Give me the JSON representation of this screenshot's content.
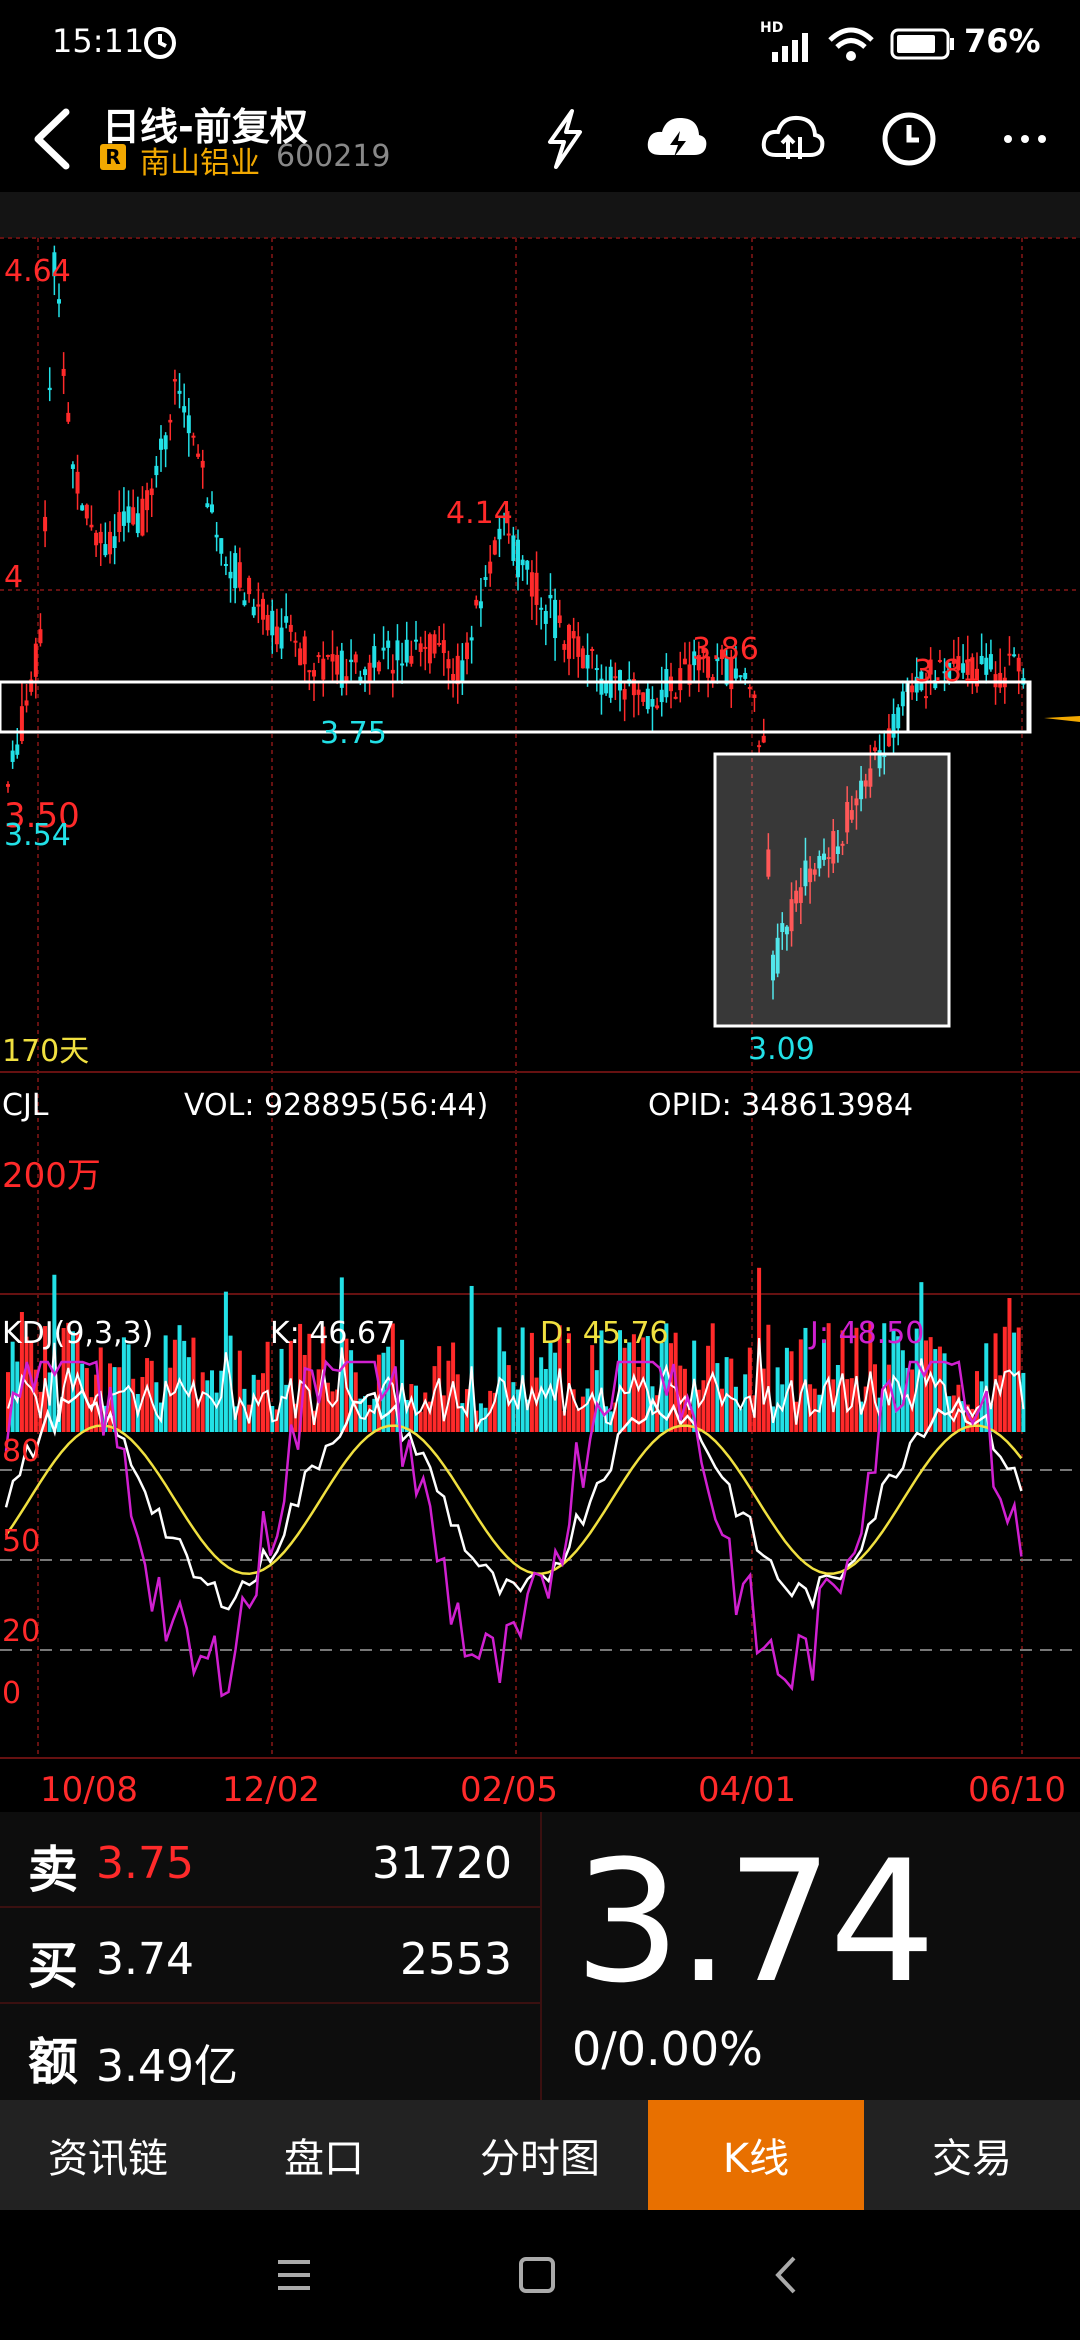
{
  "status_bar": {
    "time": "15:11",
    "battery": "76%",
    "network": "HD"
  },
  "header": {
    "title": "日线-前复权",
    "badge": "R",
    "stock_name": "南山铝业",
    "stock_code": "600219"
  },
  "chart_labels": {
    "high_main": "4.64",
    "level_4": "4",
    "level_3_50": "3.50",
    "low_left": "3.54",
    "peak_mid": "4.14",
    "low_mid": "3.75",
    "peak_386": "3.86",
    "peak_381": "3.81",
    "low_309": "3.09",
    "days": "170天"
  },
  "volume_panel": {
    "name": "CJL",
    "vol": "VOL: 928895(56:44)",
    "opid": "OPID: 348613984",
    "scale": "200万"
  },
  "kdj_panel": {
    "name": "KDJ(9,3,3)",
    "k": "K: 46.67",
    "d": "D: 45.76",
    "j": "J: 48.50",
    "levels": [
      "80",
      "50",
      "20",
      "0"
    ]
  },
  "dates": [
    "10/08",
    "12/02",
    "02/05",
    "04/01",
    "06/10"
  ],
  "quote": {
    "sell_label": "卖",
    "sell_price": "3.75",
    "sell_volume": "31720",
    "buy_label": "买",
    "buy_price": "3.74",
    "buy_volume": "2553",
    "amount_label": "额",
    "amount_value": "3.49亿",
    "last_price": "3.74",
    "change": "0/0.00%"
  },
  "tabs": [
    "资讯链",
    "盘口",
    "分时图",
    "K线",
    "交易"
  ],
  "active_tab": 3,
  "colors": {
    "up": "#ff2a2a",
    "down": "#22e0e6",
    "k_line": "#ffffff",
    "d_line": "#f0e040",
    "j_line": "#d020d0",
    "accent": "#e87000"
  },
  "chart_data": {
    "type": "candlestick",
    "y_range": [
      3.09,
      4.64
    ],
    "x_labels": [
      "10/08",
      "12/02",
      "02/05",
      "04/01",
      "06/10"
    ],
    "notable_prices": {
      "high": 4.64,
      "low": 3.09,
      "peaks": [
        4.14,
        3.86,
        3.81
      ],
      "troughs": [
        3.75,
        3.54
      ]
    },
    "indicators": {
      "K": 46.67,
      "D": 45.76,
      "J": 48.5
    },
    "volume": {
      "total": 928895,
      "ratio": "56:44"
    }
  }
}
